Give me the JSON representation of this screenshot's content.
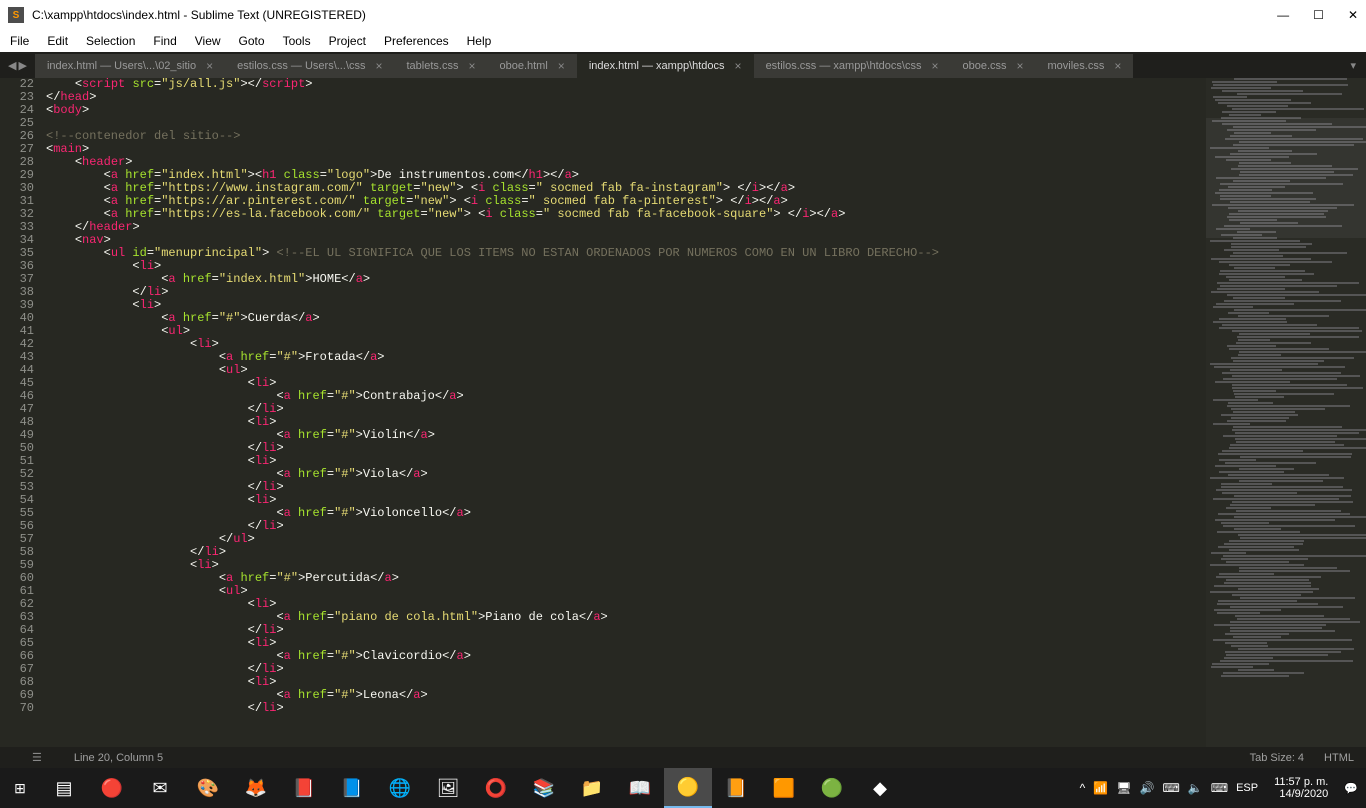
{
  "window": {
    "app_initial": "S",
    "title": "C:\\xampp\\htdocs\\index.html - Sublime Text (UNREGISTERED)",
    "min": "—",
    "max": "☐",
    "close": "✕"
  },
  "menu": {
    "items": [
      "File",
      "Edit",
      "Selection",
      "Find",
      "View",
      "Goto",
      "Tools",
      "Project",
      "Preferences",
      "Help"
    ]
  },
  "tabs": {
    "nav_left": "◀",
    "nav_right": "▶",
    "dropdown": "▾",
    "items": [
      {
        "label": "index.html — Users\\...\\02_sitio",
        "active": false
      },
      {
        "label": "estilos.css — Users\\...\\css",
        "active": false
      },
      {
        "label": "tablets.css",
        "active": false
      },
      {
        "label": "oboe.html",
        "active": false
      },
      {
        "label": "index.html — xampp\\htdocs",
        "active": true
      },
      {
        "label": "estilos.css — xampp\\htdocs\\css",
        "active": false
      },
      {
        "label": "oboe.css",
        "active": false
      },
      {
        "label": "moviles.css",
        "active": false
      }
    ]
  },
  "gutter": {
    "start": 22,
    "end": 70
  },
  "status": {
    "cursor": "Line 20, Column 5",
    "tabsize": "Tab Size: 4",
    "lang": "HTML"
  },
  "taskbar": {
    "start": "⊞",
    "items": [
      "▤",
      "🔴",
      "✉",
      "🎨",
      "🦊",
      "📕",
      "📘",
      "🌐",
      "🖼",
      "⭕",
      "📚",
      "📁",
      "📖",
      "🟡",
      "📙",
      "🟧",
      "🟢",
      "◆"
    ],
    "tray": [
      "^",
      "📶",
      "🖥",
      "🔊",
      "⌨",
      "🔈",
      "⌨"
    ],
    "lang": "ESP",
    "time": "11:57 p. m.",
    "date": "14/9/2020",
    "notif": "💬"
  }
}
